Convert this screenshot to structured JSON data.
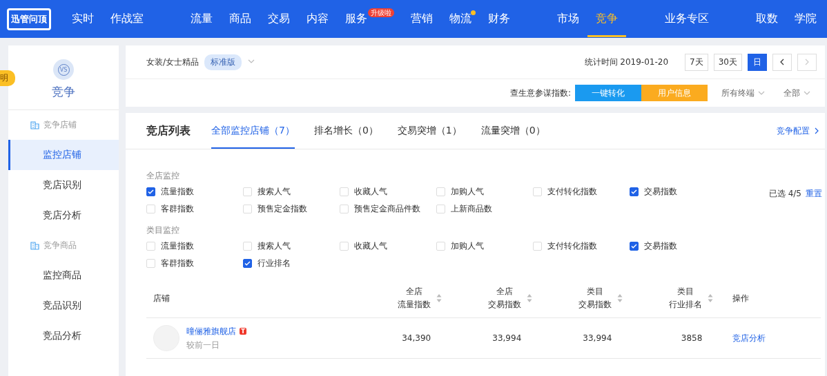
{
  "nav": {
    "logo": "迅管问顶",
    "groups": [
      [
        {
          "label": "实时",
          "selected": false
        },
        {
          "label": "作战室",
          "selected": false
        }
      ],
      [
        {
          "label": "流量",
          "selected": false
        },
        {
          "label": "商品",
          "selected": false
        },
        {
          "label": "交易",
          "selected": false
        },
        {
          "label": "内容",
          "selected": false
        },
        {
          "label": "服务",
          "selected": false,
          "badge": "升级啦"
        },
        {
          "label": "营销",
          "selected": false
        },
        {
          "label": "物流",
          "selected": false,
          "dot": true
        },
        {
          "label": "财务",
          "selected": false
        }
      ],
      [
        {
          "label": "市场",
          "selected": false
        },
        {
          "label": "竞争",
          "selected": true
        }
      ],
      [
        {
          "label": "业务专区",
          "selected": false
        }
      ],
      [
        {
          "label": "取数",
          "selected": false
        },
        {
          "label": "学院",
          "selected": false
        }
      ]
    ]
  },
  "help_tab": {
    "label": "明"
  },
  "sidebar": {
    "icon_text": "VS",
    "title": "竞争",
    "groups": [
      {
        "title": "竞争店铺",
        "items": [
          {
            "label": "监控店铺",
            "selected": true
          },
          {
            "label": "竞店识别",
            "selected": false
          },
          {
            "label": "竞店分析",
            "selected": false
          }
        ]
      },
      {
        "title": "竞争商品",
        "items": [
          {
            "label": "监控商品",
            "selected": false
          },
          {
            "label": "竞品识别",
            "selected": false
          },
          {
            "label": "竞品分析",
            "selected": false
          }
        ]
      }
    ]
  },
  "filter_bar": {
    "category": "女装/女士精品",
    "edition": "标准版",
    "stat_time": "统计时间 2019-01-20",
    "periods": [
      {
        "label": "7天",
        "selected": false
      },
      {
        "label": "30天",
        "selected": false
      },
      {
        "label": "日",
        "selected": true
      }
    ],
    "index_label": "查生意参谋指数:",
    "convert_button": "一键转化",
    "user_info_button": "用户信息",
    "dropdowns": [
      "所有终端",
      "全部"
    ]
  },
  "list": {
    "title": "竞店列表",
    "tabs": [
      {
        "label": "全部监控店铺（7）",
        "selected": true
      },
      {
        "label": "排名增长（0）",
        "selected": false
      },
      {
        "label": "交易突增（1）",
        "selected": false
      },
      {
        "label": "流量突增（0）",
        "selected": false
      }
    ],
    "config_link": "竞争配置",
    "selected_count": "已选 4/5",
    "reset_link": "重置",
    "sections": [
      {
        "title": "全店监控",
        "options": [
          {
            "label": "流量指数",
            "checked": true
          },
          {
            "label": "搜索人气",
            "checked": false
          },
          {
            "label": "收藏人气",
            "checked": false
          },
          {
            "label": "加购人气",
            "checked": false
          },
          {
            "label": "支付转化指数",
            "checked": false
          },
          {
            "label": "交易指数",
            "checked": true
          },
          {
            "label": "客群指数",
            "checked": false
          },
          {
            "label": "预售定金指数",
            "checked": false
          },
          {
            "label": "预售定金商品件数",
            "checked": false
          },
          {
            "label": "上新商品数",
            "checked": false
          }
        ]
      },
      {
        "title": "类目监控",
        "options": [
          {
            "label": "流量指数",
            "checked": false
          },
          {
            "label": "搜索人气",
            "checked": false
          },
          {
            "label": "收藏人气",
            "checked": false
          },
          {
            "label": "加购人气",
            "checked": false
          },
          {
            "label": "支付转化指数",
            "checked": false
          },
          {
            "label": "交易指数",
            "checked": true
          },
          {
            "label": "客群指数",
            "checked": false
          },
          {
            "label": "行业排名",
            "checked": true
          }
        ]
      }
    ],
    "table": {
      "columns": [
        {
          "lines": [
            "店铺"
          ],
          "sortable": false
        },
        {
          "lines": [
            "全店",
            "流量指数"
          ],
          "sortable": true
        },
        {
          "lines": [
            "全店",
            "交易指数"
          ],
          "sortable": true
        },
        {
          "lines": [
            "类目",
            "交易指数"
          ],
          "sortable": true
        },
        {
          "lines": [
            "类目",
            "行业排名"
          ],
          "sortable": true
        },
        {
          "lines": [
            "操作"
          ],
          "sortable": false
        }
      ],
      "rows": [
        {
          "store": "曈俪雅旗舰店",
          "store_badge": "T",
          "sub": "较前一日",
          "values": [
            "34,390",
            "33,994",
            "33,994",
            "3858"
          ],
          "action": "竞店分析"
        }
      ]
    }
  }
}
